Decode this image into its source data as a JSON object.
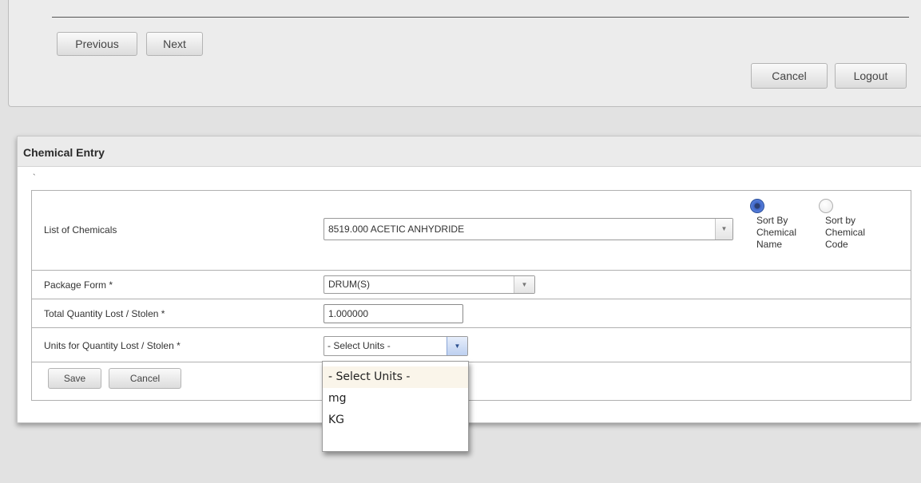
{
  "nav": {
    "previous_label": "Previous",
    "next_label": "Next",
    "cancel_label": "Cancel",
    "logout_label": "Logout"
  },
  "entry": {
    "title": "Chemical Entry",
    "tick_mark": "`",
    "fields": {
      "chemicals": {
        "label": "List of Chemicals",
        "value": "8519.000 ACETIC ANHYDRIDE"
      },
      "package_form": {
        "label": "Package Form  *",
        "value": "DRUM(S)"
      },
      "quantity": {
        "label": "Total Quantity Lost / Stolen  *",
        "value": "1.000000"
      },
      "units": {
        "label": "Units for Quantity Lost / Stolen  *",
        "value": "- Select Units -",
        "options": [
          "- Select Units -",
          "mg",
          "KG"
        ]
      }
    },
    "sort_options": {
      "by_name": "Sort By Chemical Name",
      "by_code": "Sort by Chemical Code",
      "selected": "by_name"
    },
    "actions": {
      "save_label": "Save",
      "cancel_label": "Cancel"
    }
  },
  "icons": {
    "dropdown_arrow": "chevron-down-icon"
  }
}
